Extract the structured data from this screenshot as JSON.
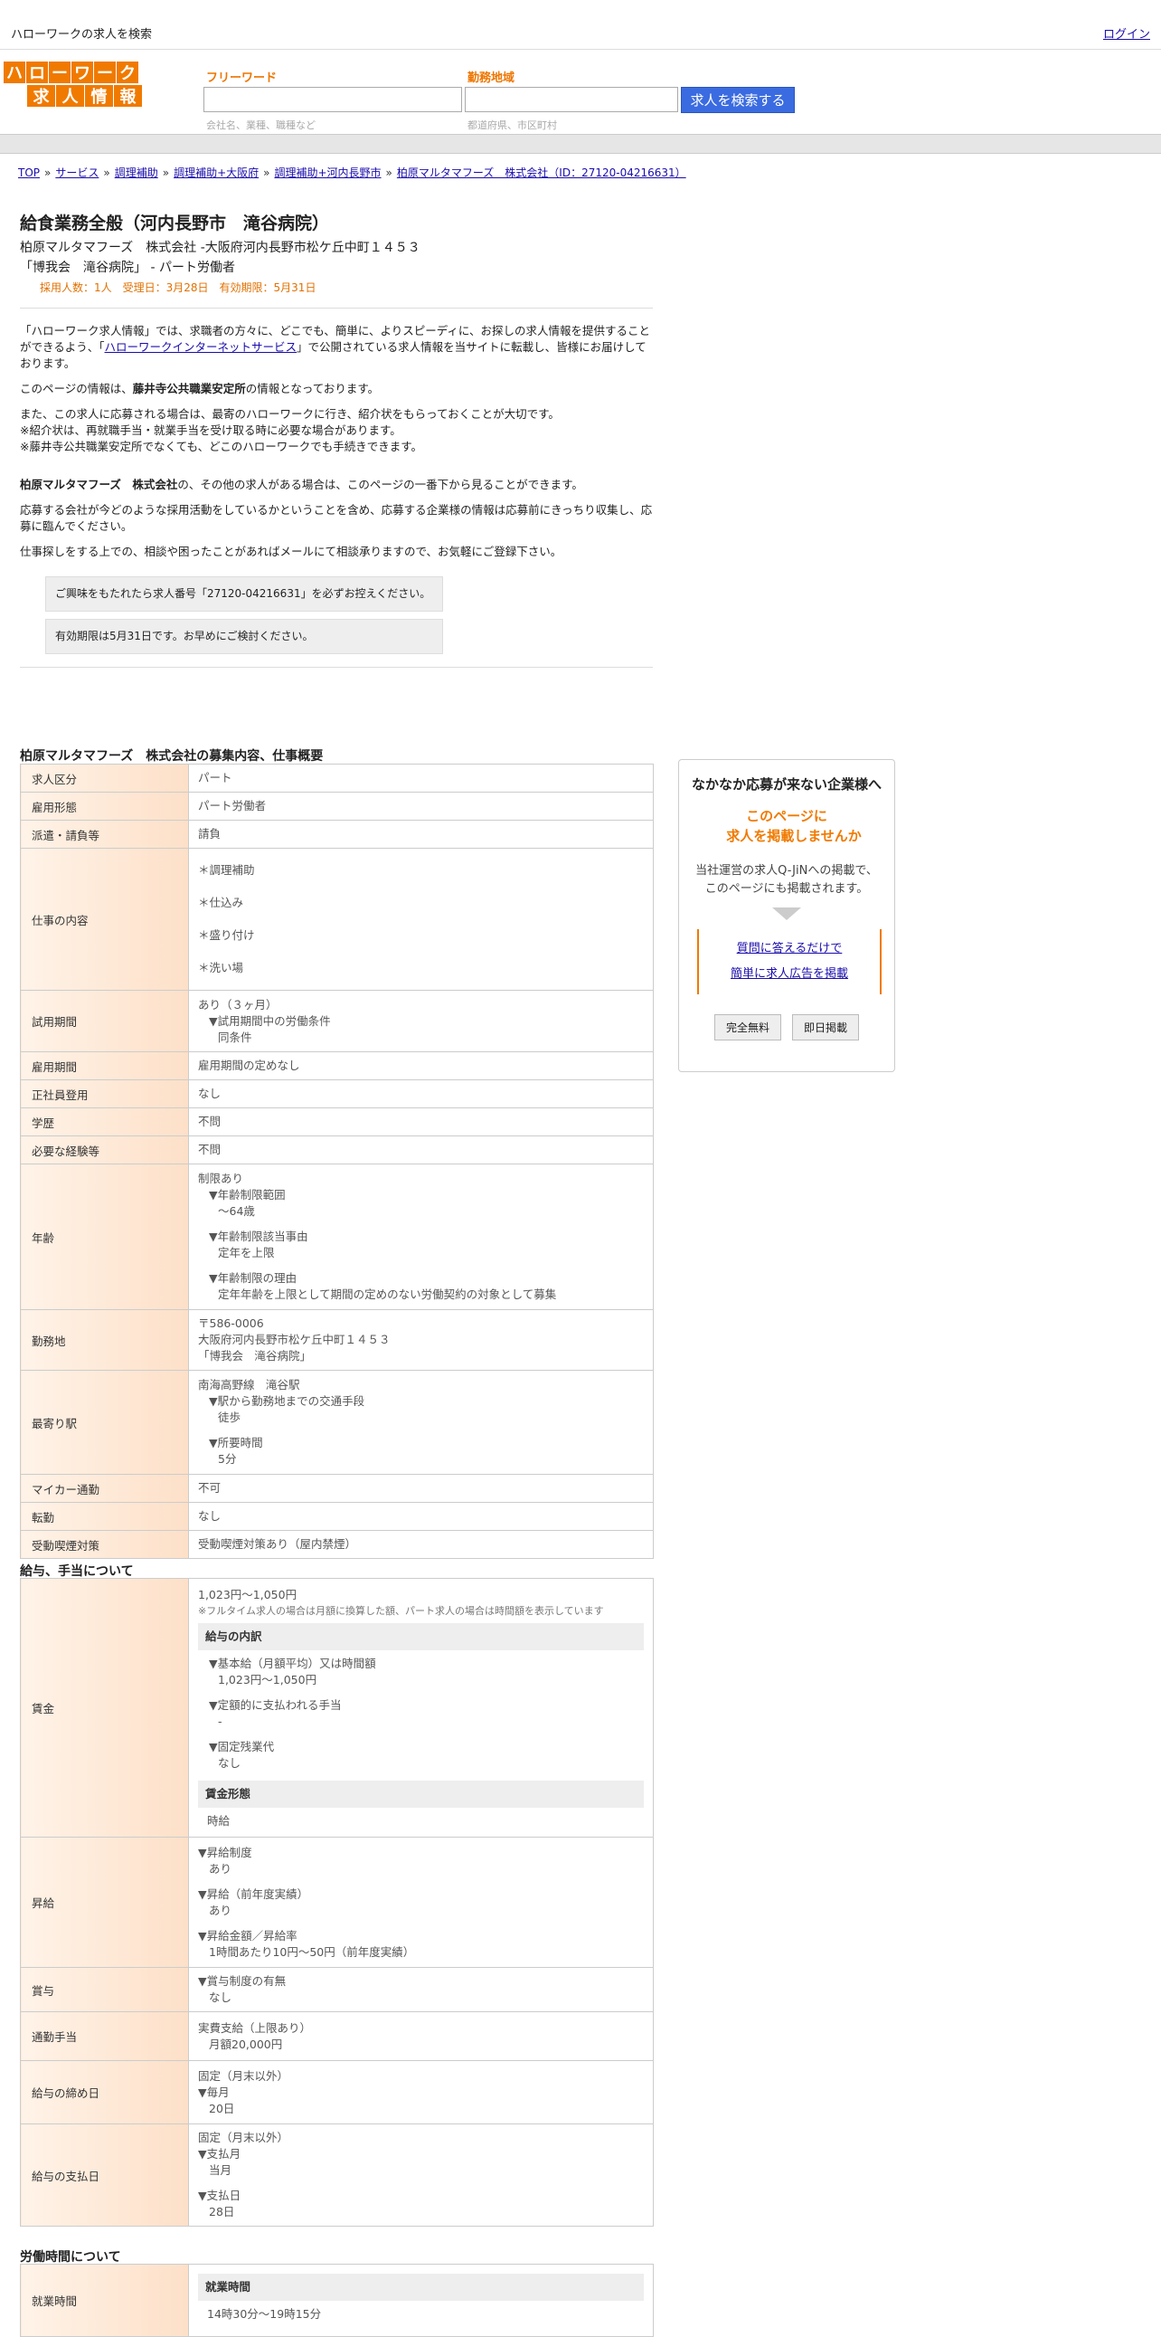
{
  "topbar": {
    "title": "ハローワークの求人を検索",
    "login": "ログイン"
  },
  "logo": {
    "row1": [
      "ハ",
      "ロ",
      "ー",
      "ワ",
      "ー",
      "ク"
    ],
    "row2": [
      "求",
      "人",
      "情",
      "報"
    ]
  },
  "search": {
    "freeword_label": "フリーワード",
    "freeword_placeholder": "会社名、業種、職種など",
    "area_label": "勤務地域",
    "area_placeholder": "都道府県、市区町村",
    "button": "求人を検索する"
  },
  "breadcrumb": [
    "TOP",
    "サービス",
    "調理補助",
    "調理補助+大阪府",
    "調理補助+河内長野市",
    "柏原マルタマフーズ　株式会社（ID：27120-04216631）"
  ],
  "job": {
    "title": "給食業務全般（河内長野市　滝谷病院）",
    "company_line": "柏原マルタマフーズ　株式会社 -大阪府河内長野市松ケ丘中町１４５３",
    "place_line": "「博我会　滝谷病院」 - パート労働者",
    "meta": "採用人数：1人　受理日：3月28日　有効期限：5月31日"
  },
  "intro": {
    "p1_a": "「ハローワーク求人情報」では、求職者の方々に、どこでも、簡単に、よりスピーディに、お探しの求人情報を提供することができるよう、「",
    "p1_link": "ハローワークインターネットサービス",
    "p1_b": "」で公開されている求人情報を当サイトに転載し、皆様にお届けしております。",
    "p2_a": "このページの情報は、",
    "p2_bold": "藤井寺公共職業安定所",
    "p2_b": "の情報となっております。",
    "p3": "また、この求人に応募される場合は、最寄のハローワークに行き、紹介状をもらっておくことが大切です。",
    "p3b": "※紹介状は、再就職手当・就業手当を受け取る時に必要な場合があります。",
    "p3c": "※藤井寺公共職業安定所でなくても、どこのハローワークでも手続きできます。",
    "p4_bold": "柏原マルタマフーズ　株式会社",
    "p4": "の、その他の求人がある場合は、このページの一番下から見ることができます。",
    "p5": "応募する会社が今どのような採用活動をしているかということを含め、応募する企業様の情報は応募前にきっちり収集し、応募に臨んでください。",
    "p6": "仕事探しをする上での、相談や困ったことがあればメールにて相談承りますので、お気軽にご登録下さい。",
    "box1": "ご興味をもたれたら求人番号「27120-04216631」を必ずお控えください。",
    "box2": "有効期限は5月31日です。お早めにご検討ください。"
  },
  "sections": {
    "s1": "柏原マルタマフーズ　株式会社の募集内容、仕事概要",
    "s2": "給与、手当について",
    "s3": "労働時間について"
  },
  "t1": [
    {
      "k": "求人区分",
      "v": "パート"
    },
    {
      "k": "雇用形態",
      "v": "パート労働者"
    },
    {
      "k": "派遣・請負等",
      "v": "請負"
    }
  ],
  "work": {
    "k": "仕事の内容",
    "items": [
      "＊調理補助",
      "＊仕込み",
      "＊盛り付け",
      "＊洗い場"
    ]
  },
  "trial": {
    "k": "試用期間",
    "v1": "あり（３ヶ月）",
    "v2": "▼試用期間中の労働条件",
    "v3": "同条件"
  },
  "t2": [
    {
      "k": "雇用期間",
      "v": "雇用期間の定めなし"
    },
    {
      "k": "正社員登用",
      "v": "なし"
    },
    {
      "k": "学歴",
      "v": "不問"
    },
    {
      "k": "必要な経験等",
      "v": "不問"
    }
  ],
  "age": {
    "k": "年齢",
    "v1": "制限あり",
    "l1": "▼年齢制限範囲",
    "v2": "〜64歳",
    "l2": "▼年齢制限該当事由",
    "v3": "定年を上限",
    "l3": "▼年齢制限の理由",
    "v4": "定年年齢を上限として期間の定めのない労働契約の対象として募集"
  },
  "loc": {
    "k": "勤務地",
    "v1": "〒586-0006",
    "v2": "大阪府河内長野市松ケ丘中町１４５３",
    "v3": "「博我会　滝谷病院」"
  },
  "station": {
    "k": "最寄り駅",
    "v1": "南海高野線　滝谷駅",
    "l1": "▼駅から勤務地までの交通手段",
    "v2": "徒歩",
    "l2": "▼所要時間",
    "v3": "5分"
  },
  "t3": [
    {
      "k": "マイカー通勤",
      "v": "不可"
    },
    {
      "k": "転勤",
      "v": "なし"
    },
    {
      "k": "受動喫煙対策",
      "v": "受動喫煙対策あり（屋内禁煙）"
    }
  ],
  "wage": {
    "k": "賃金",
    "v1": "1,023円〜1,050円",
    "note": "※フルタイム求人の場合は月額に換算した額、パート求人の場合は時間額を表示しています",
    "g1": "給与の内訳",
    "l1": "▼基本給（月額平均）又は時間額",
    "v2": "1,023円〜1,050円",
    "l2": "▼定額的に支払われる手当",
    "v3": "-",
    "l3": "▼固定残業代",
    "v4": "なし",
    "g2": "賃金形態",
    "v5": "時給"
  },
  "raise": {
    "k": "昇給",
    "l1": "▼昇給制度",
    "v1": "あり",
    "l2": "▼昇給（前年度実績）",
    "v2": "あり",
    "l3": "▼昇給金額／昇給率",
    "v3": "1時間あたり10円〜50円（前年度実績）"
  },
  "bonus": {
    "k": "賞与",
    "l1": "▼賞与制度の有無",
    "v1": "なし"
  },
  "commute": {
    "k": "通勤手当",
    "v1": "実費支給（上限あり）",
    "v2": "月額20,000円"
  },
  "cutoff": {
    "k": "給与の締め日",
    "v1": "固定（月末以外）",
    "l1": "▼毎月",
    "v2": "20日"
  },
  "payday": {
    "k": "給与の支払日",
    "v1": "固定（月末以外）",
    "l1": "▼支払月",
    "v2": "当月",
    "l2": "▼支払日",
    "v3": "28日"
  },
  "hours": {
    "k": "就業時間",
    "g1": "就業時間",
    "v1": "14時30分〜19時15分"
  },
  "side": {
    "title": "なかなか応募が来ない企業様へ",
    "orange1": "このページに",
    "orange2": "求人を掲載しませんか",
    "desc1": "当社運営の求人Q-JiNへの掲載で、",
    "desc2": "このページにも掲載されます。",
    "link1": "質問に答えるだけで",
    "link2": "簡単に求人広告を掲載",
    "btn1": "完全無料",
    "btn2": "即日掲載"
  }
}
